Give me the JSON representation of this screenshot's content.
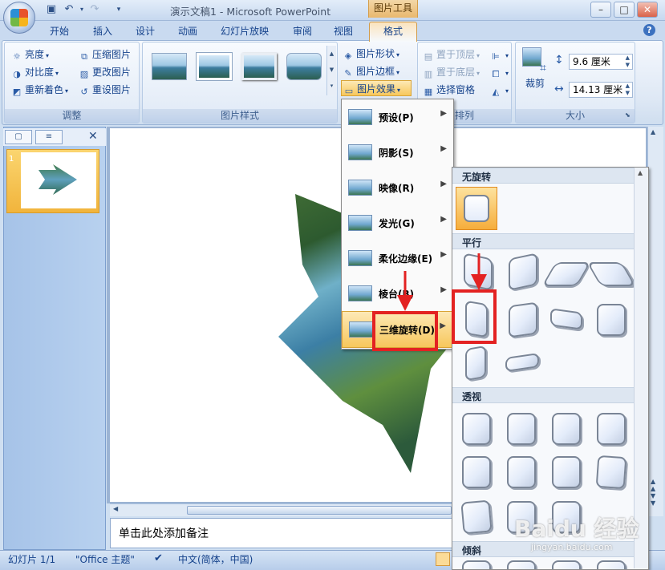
{
  "window": {
    "title": "演示文稿1 - Microsoft PowerPoint",
    "context_tab_group": "图片工具",
    "min_label": "–",
    "max_label": "□",
    "close_label": "✕"
  },
  "qat": {
    "save_icon": "save-icon",
    "undo_icon": "undo-icon",
    "redo_icon": "redo-icon"
  },
  "tabs": [
    "开始",
    "插入",
    "设计",
    "动画",
    "幻灯片放映",
    "审阅",
    "视图",
    "格式"
  ],
  "active_tab": "格式",
  "ribbon": {
    "adjust": {
      "label": "调整",
      "items": [
        "亮度",
        "对比度",
        "重新着色",
        "压缩图片",
        "更改图片",
        "重设图片"
      ]
    },
    "picture_styles": {
      "label": "图片样式"
    },
    "picture_cmds": [
      "图片形状",
      "图片边框",
      "图片效果"
    ],
    "arrange": {
      "label": "排列",
      "items": [
        "置于顶层",
        "置于底层",
        "选择窗格"
      ]
    },
    "size": {
      "label": "大小",
      "crop_label": "裁剪",
      "height": "9.6 厘米",
      "width": "14.13 厘米"
    }
  },
  "slides_pane": {
    "slide_number": "1"
  },
  "notes_placeholder": "单击此处添加备注",
  "status": {
    "slide": "幻灯片 1/1",
    "theme": "\"Office 主题\"",
    "language": "中文(简体，中国)"
  },
  "effects_menu": {
    "items": [
      {
        "label": "预设(P)",
        "icon": "preset-icon"
      },
      {
        "label": "阴影(S)",
        "icon": "shadow-icon"
      },
      {
        "label": "映像(R)",
        "icon": "reflection-icon"
      },
      {
        "label": "发光(G)",
        "icon": "glow-icon"
      },
      {
        "label": "柔化边缘(E)",
        "icon": "soft-edges-icon"
      },
      {
        "label": "棱台(B)",
        "icon": "bevel-icon"
      },
      {
        "label": "三维旋转(D)",
        "icon": "3d-rotation-icon"
      }
    ],
    "highlighted": "三维旋转(D)"
  },
  "rotation_gallery": {
    "sections": [
      "无旋转",
      "平行",
      "透视",
      "倾斜"
    ]
  },
  "watermark": {
    "brand": "Baidu 经验",
    "url": "jingyan.baidu.com"
  },
  "colors": {
    "accent_orange": "#f7c75c",
    "annotation_red": "#e32222",
    "ribbon_blue": "#15428b"
  }
}
